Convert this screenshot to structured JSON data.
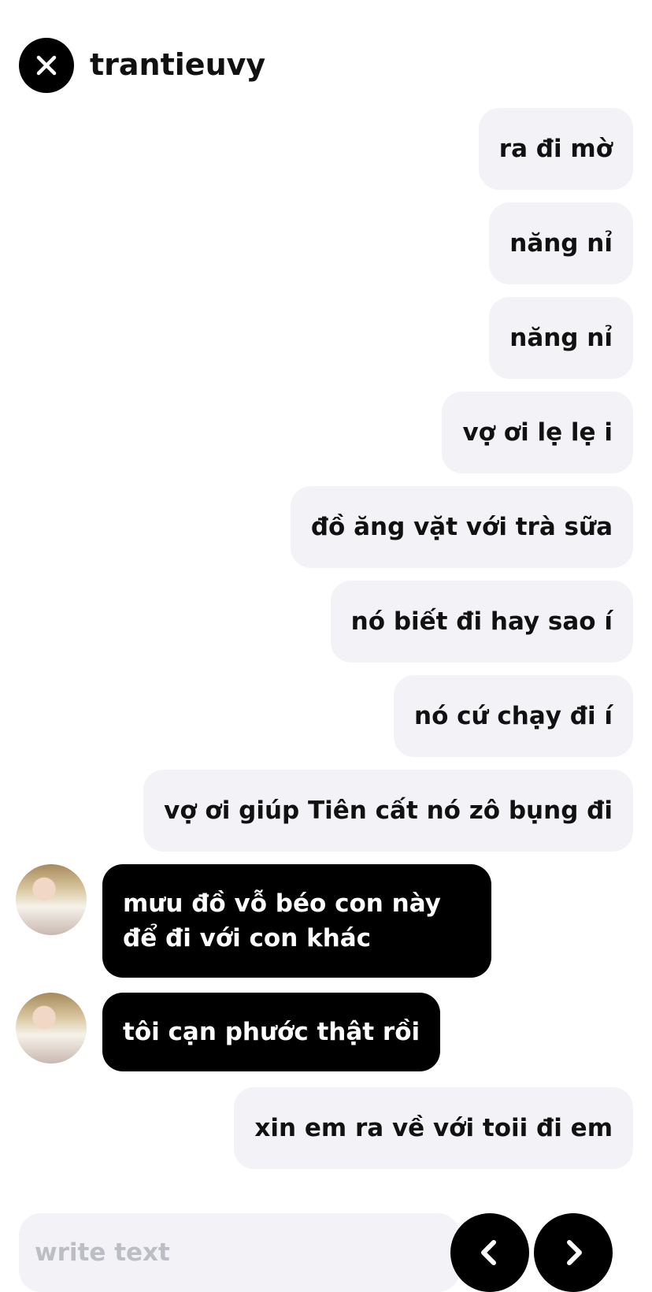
{
  "header": {
    "title": "trantieuvy",
    "close_icon": "close-icon"
  },
  "messages": [
    {
      "direction": "out",
      "text": "ra đi mờ"
    },
    {
      "direction": "out",
      "text": "năng nỉ"
    },
    {
      "direction": "out",
      "text": "năng nỉ"
    },
    {
      "direction": "out",
      "text": "vợ ơi lẹ lẹ i"
    },
    {
      "direction": "out",
      "text": "đồ ăng vặt với trà sữa"
    },
    {
      "direction": "out",
      "text": "nó biết đi hay sao í"
    },
    {
      "direction": "out",
      "text": "nó cứ chạy đi í"
    },
    {
      "direction": "out",
      "text": "vợ ơi giúp Tiên cất nó zô bụng đi"
    },
    {
      "direction": "in",
      "text": "mưu đồ vỗ béo con này để đi với con khác"
    },
    {
      "direction": "in",
      "text": "tôi cạn phước thật rồi"
    },
    {
      "direction": "out",
      "text": "xin em ra về với toii đi em"
    }
  ],
  "composer": {
    "placeholder": "write text",
    "prev_icon": "chevron-left-icon",
    "next_icon": "chevron-right-icon"
  },
  "colors": {
    "outgoing_bubble": "#f2f2f7",
    "incoming_bubble": "#000000",
    "button": "#000000"
  }
}
